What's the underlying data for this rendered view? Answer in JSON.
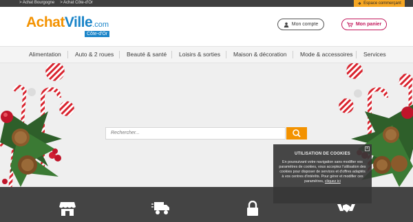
{
  "topbar": {
    "links": [
      "> Achat Bourgogne",
      "> Achat Côte-d'Or"
    ],
    "merchant_label": "Espace commerçant"
  },
  "logo": {
    "part1": "Achat",
    "part2": "Ville",
    "part3": ".com",
    "region": "Côte-d'Or"
  },
  "header": {
    "account_label": "Mon compte",
    "cart_label": "Mon panier"
  },
  "nav": {
    "items": [
      "Alimentation",
      "Auto & 2 roues",
      "Beauté & santé",
      "Loisirs & sorties",
      "Maison & décoration",
      "Mode & accessoires",
      "Services"
    ]
  },
  "search": {
    "placeholder": "Rechercher..."
  },
  "cookie": {
    "title": "UTILISATION DE COOKIES",
    "body": "En poursuivant votre navigation sans modifier vos paramètres de cookies, vous acceptez l'utilisation des cookies pour disposer de services et d'offres adaptés à vos centres d'intérêts. Pour gérer et modifier ces paramètres,",
    "link": "cliquez ici",
    "close": "x"
  },
  "icons": {
    "band": [
      "shop-icon",
      "delivery-truck-icon",
      "lock-icon",
      "handshake-icon"
    ]
  },
  "colors": {
    "orange": "#f39200",
    "blue": "#1a84c8",
    "pink": "#c2185b",
    "dark": "#444444"
  }
}
